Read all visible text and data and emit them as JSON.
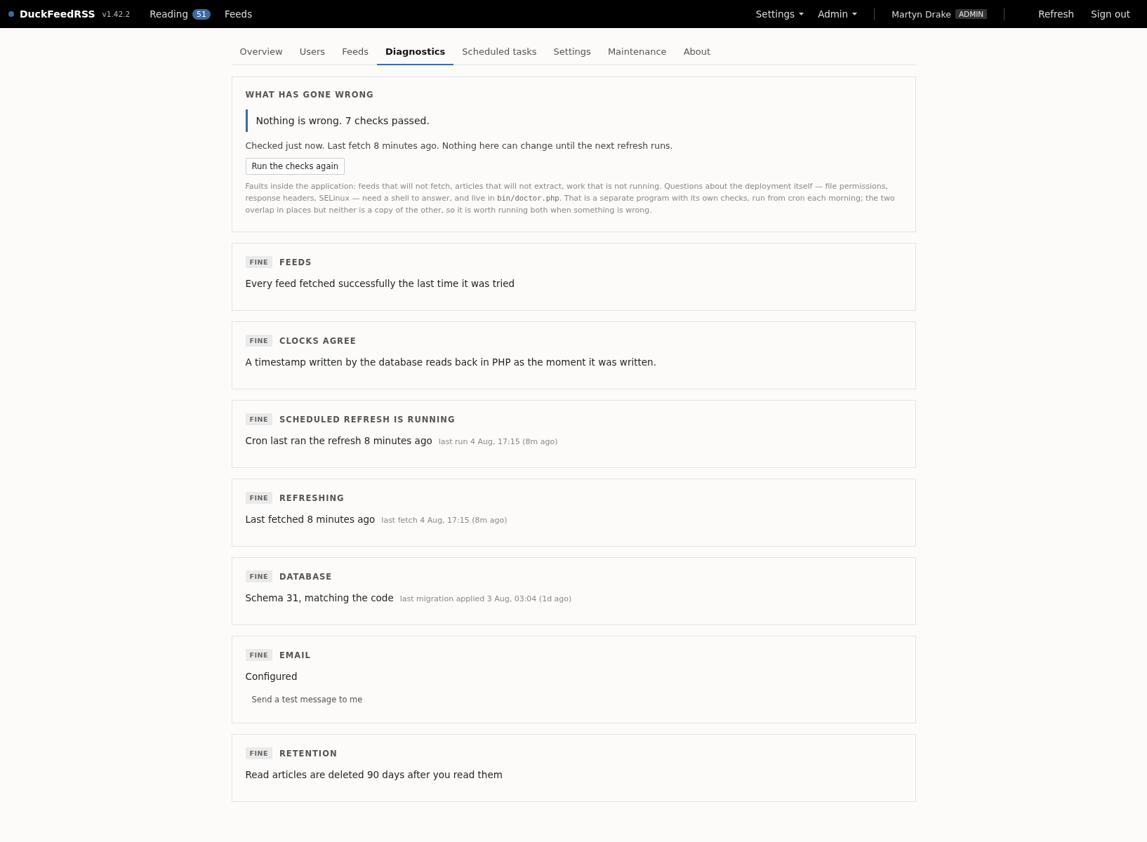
{
  "topbar": {
    "brand": "DuckFeedRSS",
    "version": "v1.42.2",
    "nav": [
      {
        "label": "Reading",
        "count": "51"
      },
      {
        "label": "Feeds"
      }
    ],
    "menus": [
      "Settings",
      "Admin"
    ],
    "user": {
      "name": "Martyn Drake",
      "role": "ADMIN"
    },
    "links": [
      "Refresh",
      "Sign out"
    ]
  },
  "tabs": [
    {
      "label": "Overview",
      "selected": false
    },
    {
      "label": "Users",
      "selected": false
    },
    {
      "label": "Feeds",
      "selected": false
    },
    {
      "label": "Diagnostics",
      "selected": true
    },
    {
      "label": "Scheduled tasks",
      "selected": false
    },
    {
      "label": "Settings",
      "selected": false
    },
    {
      "label": "Maintenance",
      "selected": false
    },
    {
      "label": "About",
      "selected": false
    }
  ],
  "summary": {
    "heading": "WHAT HAS GONE WRONG",
    "verdict": "Nothing is wrong. 7 checks passed.",
    "checked": "Checked just now. Last fetch 8 minutes ago. Nothing here can change until the next refresh runs.",
    "button": "Run the checks again",
    "note_before": "Faults inside the application: feeds that will not fetch, articles that will not extract, work that is not running. Questions about the deployment itself — file permissions, response headers, SELinux — need a shell to answer, and live in",
    "note_code": "bin/doctor.php",
    "note_after": ". That is a separate program with its own checks, run from cron each morning; the two overlap in places but neither is a copy of the other, so it is worth running both when something is wrong."
  },
  "checks": [
    {
      "status": "FINE",
      "title": "FEEDS",
      "message": "Every feed fetched successfully the last time it was tried"
    },
    {
      "status": "FINE",
      "title": "CLOCKS AGREE",
      "message": "A timestamp written by the database reads back in PHP as the moment it was written."
    },
    {
      "status": "FINE",
      "title": "SCHEDULED REFRESH IS RUNNING",
      "message": "Cron last ran the refresh 8 minutes ago",
      "detail": "last run 4 Aug, 17:15 (8m ago)"
    },
    {
      "status": "FINE",
      "title": "REFRESHING",
      "message": "Last fetched 8 minutes ago",
      "detail": "last fetch 4 Aug, 17:15 (8m ago)"
    },
    {
      "status": "FINE",
      "title": "DATABASE",
      "message": "Schema 31, matching the code",
      "detail": "last migration applied 3 Aug, 03:04 (1d ago)"
    },
    {
      "status": "FINE",
      "title": "EMAIL",
      "message": "Configured",
      "action": "Send a test message to me"
    },
    {
      "status": "FINE",
      "title": "RETENTION",
      "message": "Read articles are deleted 90 days after you read them"
    }
  ]
}
